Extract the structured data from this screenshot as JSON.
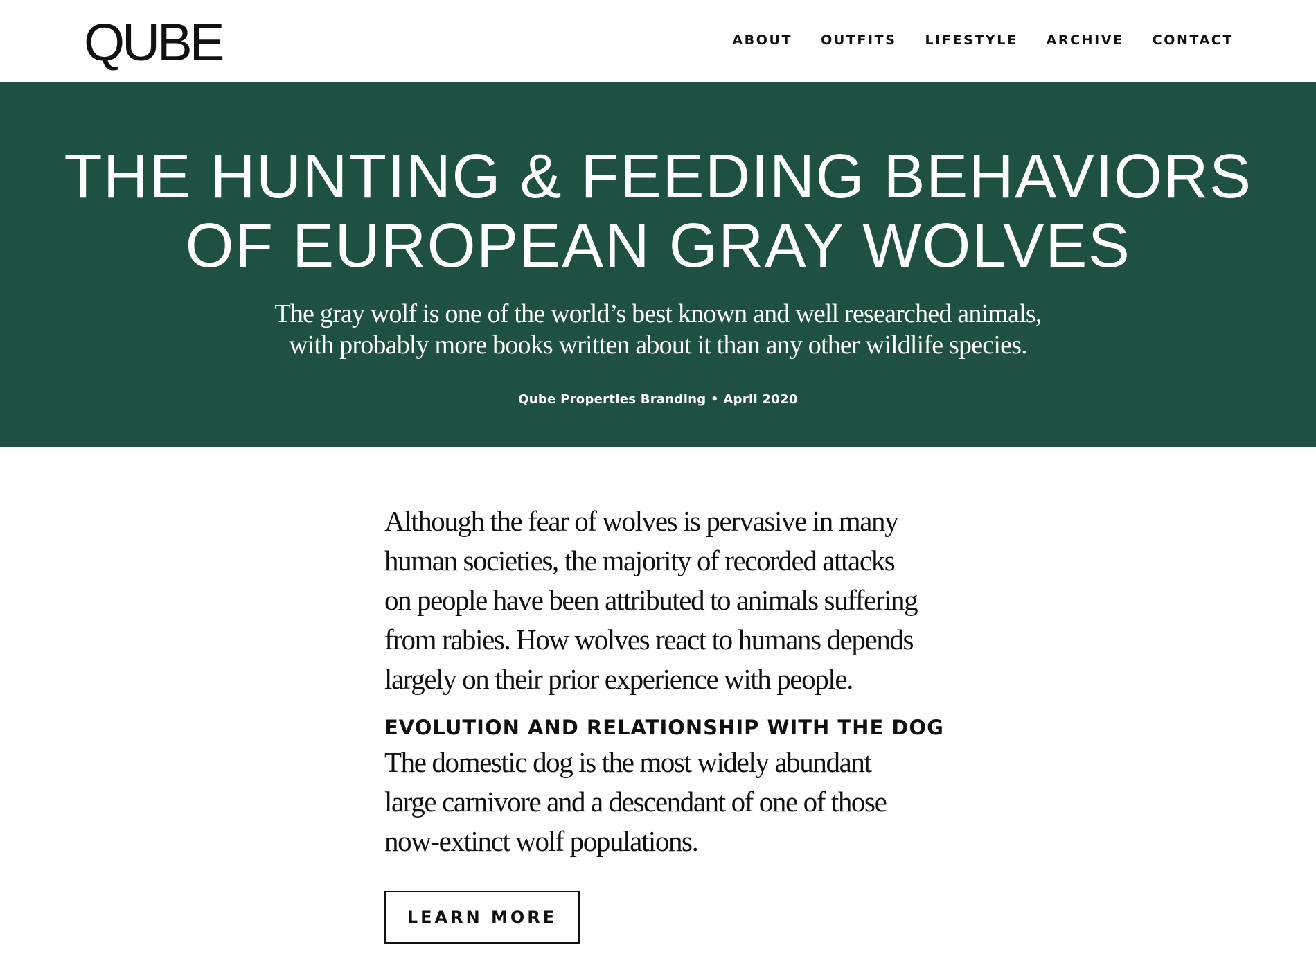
{
  "brand": {
    "logo_text": "QUBE"
  },
  "nav": {
    "items": [
      {
        "label": "ABOUT"
      },
      {
        "label": "OUTFITS"
      },
      {
        "label": "LIFESTYLE"
      },
      {
        "label": "ARCHIVE"
      },
      {
        "label": "CONTACT"
      }
    ]
  },
  "hero": {
    "title_lines": [
      "THE HUNTING & FEEDING BEHAVIORS",
      "OF EUROPEAN GRAY WOLVES"
    ],
    "subtitle_lines": [
      "The gray wolf is one of the world’s best known and well researched animals,",
      "with probably more books written about it than any other wildlife species."
    ],
    "meta": "Qube Properties Branding • April 2020",
    "background_color": "#1e5141"
  },
  "article": {
    "lead_lines": [
      "Although the fear of wolves is pervasive in many",
      "human societies, the majority of recorded attacks",
      "on people have been attributed to animals suffering",
      "from rabies. How wolves react to humans depends",
      "largely on their prior experience with people."
    ],
    "section_heading": "EVOLUTION AND RELATIONSHIP WITH THE DOG",
    "body_lines": [
      "The domestic dog is the most widely abundant",
      "large carnivore and a descendant of one of those",
      "now-extinct wolf populations."
    ],
    "cta_label": "LEARN MORE"
  }
}
